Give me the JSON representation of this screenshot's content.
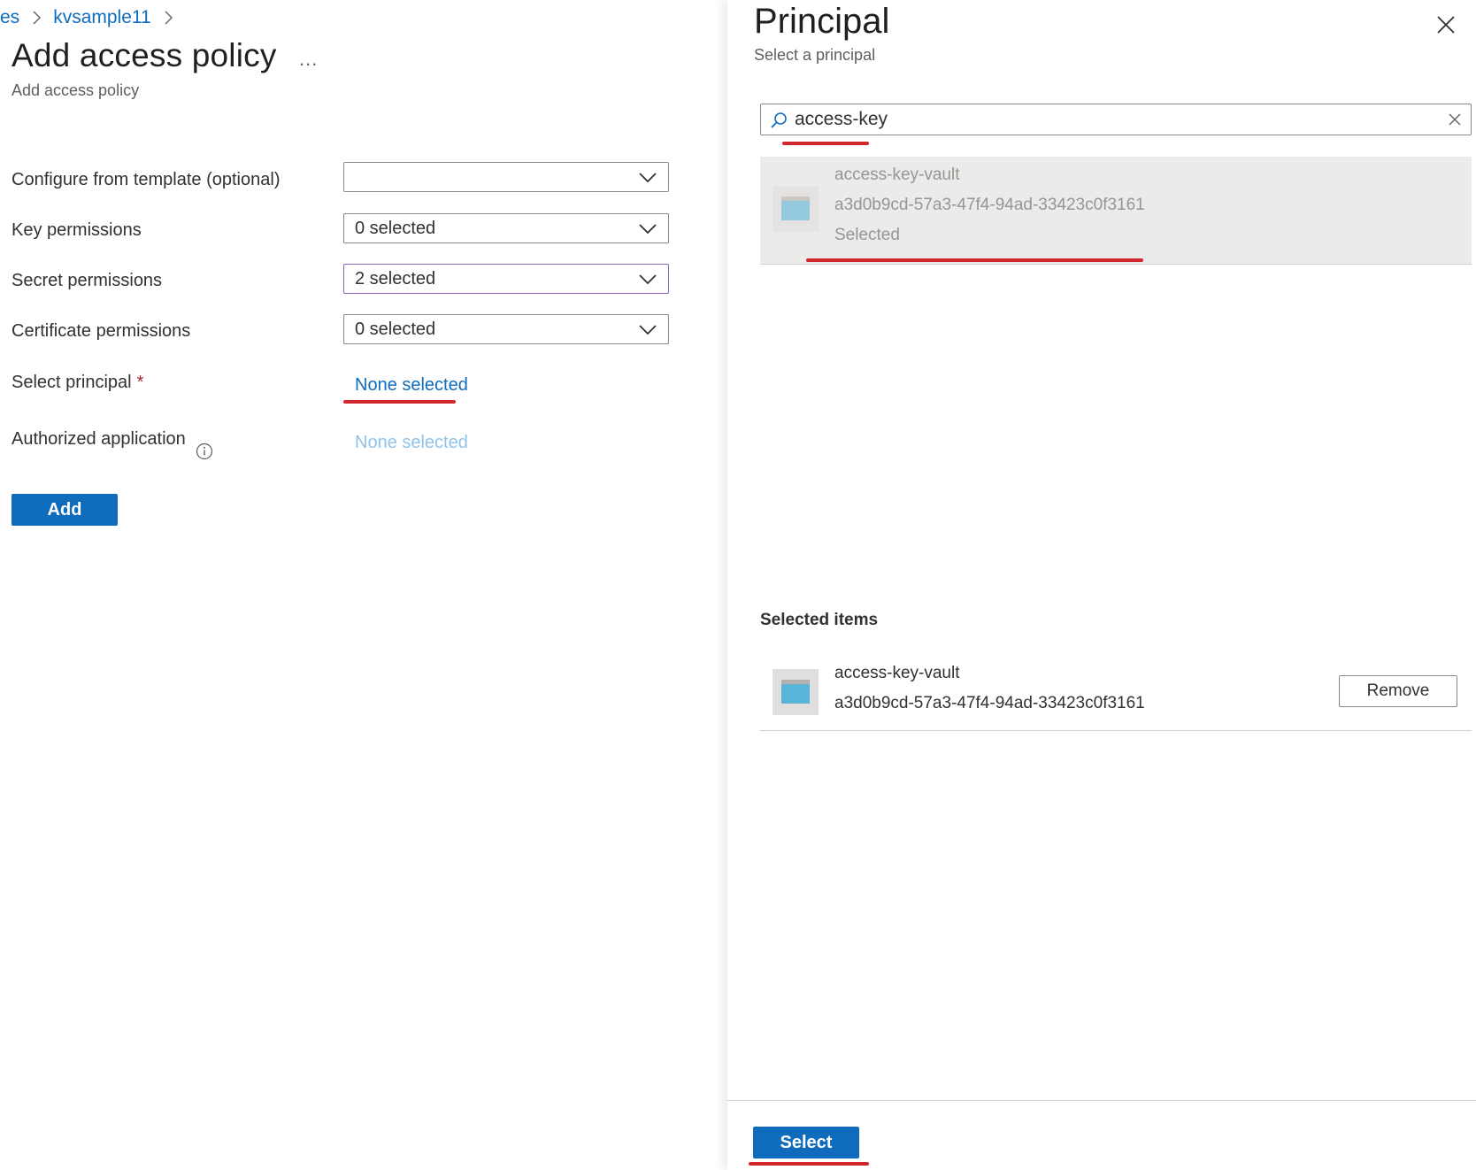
{
  "breadcrumb": {
    "prev": "es",
    "current": "kvsample11"
  },
  "blade": {
    "title": "Add access policy",
    "ellipsis": "...",
    "subtitle": "Add access policy"
  },
  "form": {
    "template_label": "Configure from template (optional)",
    "template_value": "",
    "key_label": "Key permissions",
    "key_value": "0 selected",
    "secret_label": "Secret permissions",
    "secret_value": "2 selected",
    "cert_label": "Certificate permissions",
    "cert_value": "0 selected",
    "principal_label": "Select principal",
    "principal_required": "*",
    "principal_value": "None selected",
    "authapp_label": "Authorized application",
    "authapp_value": "None selected",
    "add_label": "Add"
  },
  "panel": {
    "title": "Principal",
    "subtitle": "Select a principal",
    "search_value": "access-key",
    "result": {
      "name": "access-key-vault",
      "id": "a3d0b9cd-57a3-47f4-94ad-33423c0f3161",
      "status": "Selected"
    },
    "selected_heading": "Selected items",
    "selected_item": {
      "name": "access-key-vault",
      "id": "a3d0b9cd-57a3-47f4-94ad-33423c0f3161",
      "remove_label": "Remove"
    },
    "select_label": "Select"
  },
  "colors": {
    "accent": "#0f6cbd",
    "annotation": "#d0262d",
    "focus_border": "#8764b8"
  },
  "icons": [
    "chevron-right-icon",
    "chevron-down-icon",
    "info-icon",
    "close-icon",
    "search-icon",
    "app-registration-icon"
  ]
}
